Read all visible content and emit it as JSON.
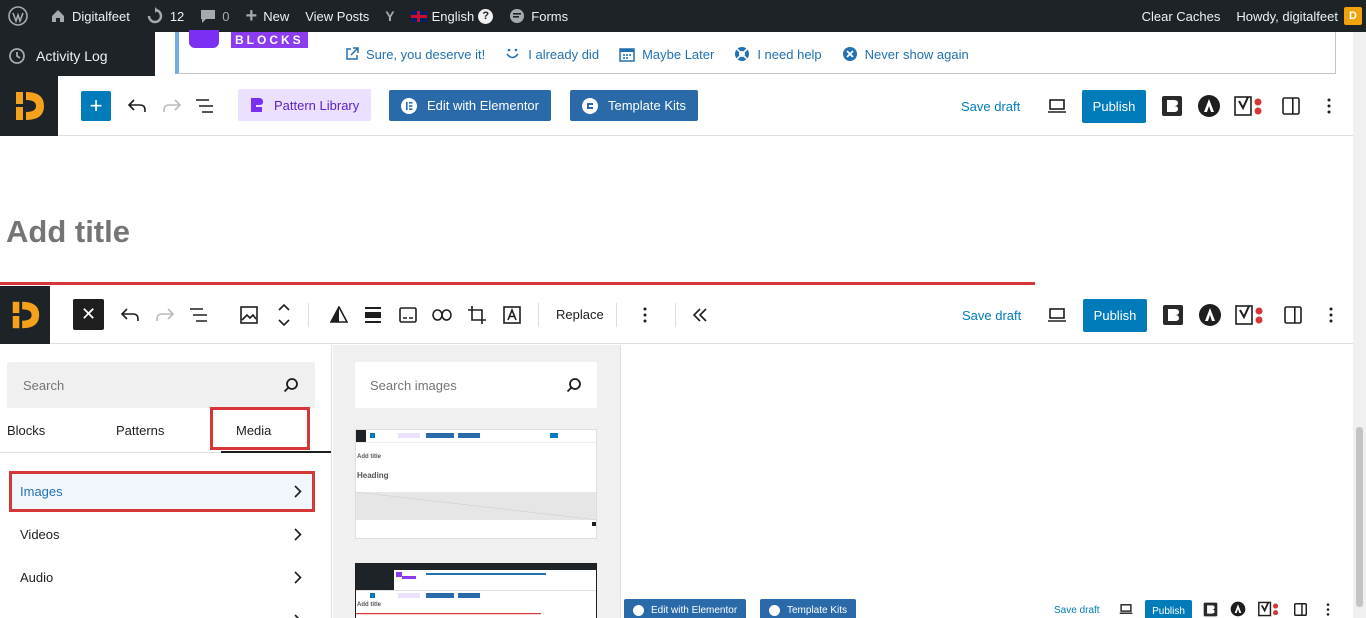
{
  "admin_bar": {
    "site_name": "Digitalfeet",
    "updates_count": "12",
    "comments_count": "0",
    "new_label": "New",
    "view_posts_label": "View Posts",
    "language_label": "English",
    "forms_label": "Forms",
    "clear_caches_label": "Clear Caches",
    "howdy_label": "Howdy, digitalfeet"
  },
  "admin_menu": {
    "activity_log_label": "Activity Log"
  },
  "notice": {
    "brand_word": "BLOCKS",
    "links": [
      {
        "label": "Sure, you deserve it!",
        "icon": "external-link-icon"
      },
      {
        "label": "I already did",
        "icon": "smile-icon"
      },
      {
        "label": "Maybe Later",
        "icon": "calendar-icon"
      },
      {
        "label": "I need help",
        "icon": "lifebuoy-icon"
      },
      {
        "label": "Never show again",
        "icon": "close-circle-icon"
      }
    ]
  },
  "editor_header": {
    "pattern_library_label": "Pattern Library",
    "edit_with_elementor_label": "Edit with Elementor",
    "template_kits_label": "Template Kits",
    "save_draft_label": "Save draft",
    "publish_label": "Publish"
  },
  "post": {
    "title_placeholder": "Add title"
  },
  "block_toolbar": {
    "replace_label": "Replace",
    "save_draft_label": "Save draft",
    "publish_label": "Publish"
  },
  "inserter": {
    "search_placeholder": "Search",
    "tabs": [
      {
        "label": "Blocks"
      },
      {
        "label": "Patterns"
      },
      {
        "label": "Media"
      }
    ],
    "active_tab": "Media",
    "categories": [
      {
        "label": "Images"
      },
      {
        "label": "Videos"
      },
      {
        "label": "Audio"
      }
    ]
  },
  "media_panel": {
    "search_placeholder": "Search images",
    "thumb1": {
      "add_title": "Add title",
      "heading": "Heading"
    },
    "thumb2": {
      "add_title": "Add title"
    }
  },
  "canvas_mini_header": {
    "edit_with_elementor_label": "Edit with Elementor",
    "template_kits_label": "Template Kits",
    "save_draft_label": "Save draft",
    "publish_label": "Publish"
  },
  "colors": {
    "admin_bar_bg": "#1d2327",
    "wp_blue": "#007cba",
    "highlight_red": "#d63638",
    "purple_brand": "#8c3cf0"
  }
}
